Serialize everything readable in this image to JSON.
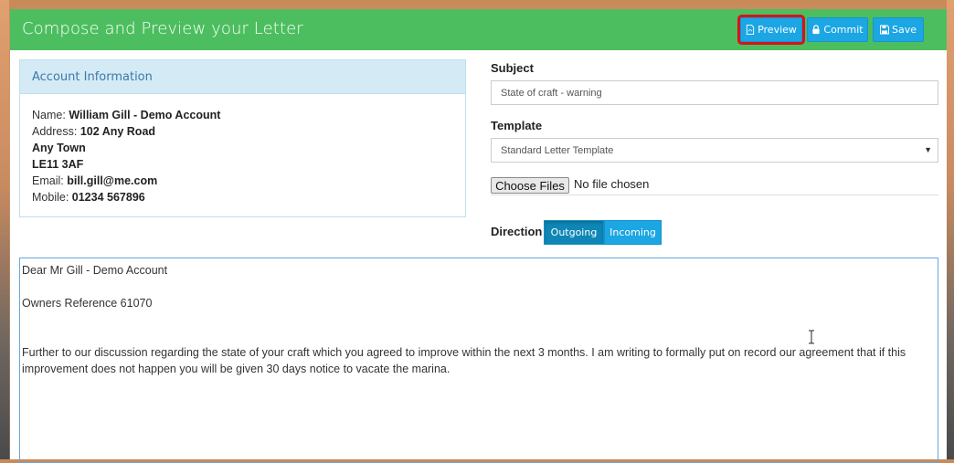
{
  "header": {
    "title": "Compose and Preview your Letter",
    "buttons": {
      "preview": "Preview",
      "commit": "Commit",
      "save": "Save"
    },
    "accent_color": "#4cbe5f",
    "button_color": "#1ca6e3",
    "highlight_color": "#d8121c"
  },
  "account": {
    "heading": "Account Information",
    "name_label": "Name:",
    "name_value": "William Gill - Demo Account",
    "address_label": "Address:",
    "address_line1": "102 Any Road",
    "address_line2": "Any Town",
    "address_line3": "LE11 3AF",
    "email_label": "Email:",
    "email_value": "bill.gill@me.com",
    "mobile_label": "Mobile:",
    "mobile_value": "01234 567896"
  },
  "form": {
    "subject_label": "Subject",
    "subject_value": "State of craft - warning",
    "template_label": "Template",
    "template_value": "Standard Letter Template",
    "file_button": "Choose Files",
    "file_status": "No file chosen",
    "direction_label": "Direction",
    "direction_options": [
      "Outgoing",
      "Incoming"
    ],
    "direction_selected": "Outgoing"
  },
  "letter": {
    "salutation": "Dear Mr Gill - Demo Account",
    "reference": "Owners Reference 61070",
    "body_line1": "Further to our discussion regarding the state of your craft which you agreed to improve within the next 3 months.  I am writing to formally put on record our agreement that if this",
    "body_line2": "improvement does not happen you will be given 30 days notice to vacate the marina."
  }
}
